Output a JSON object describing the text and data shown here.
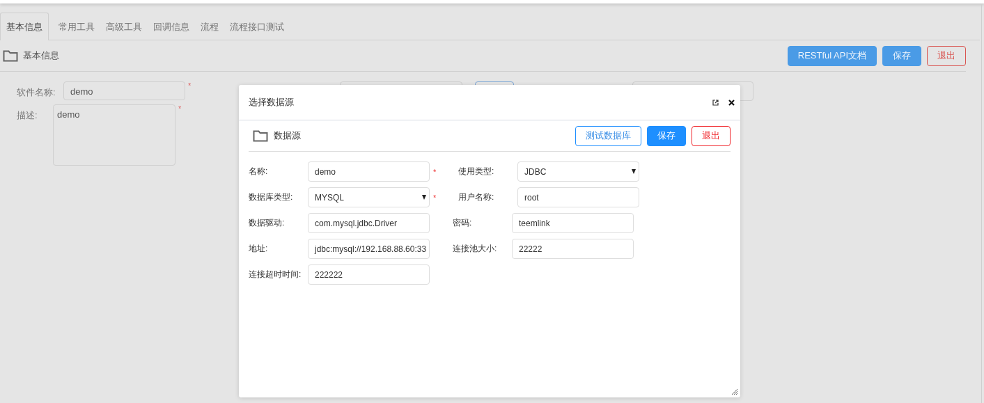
{
  "tabs": [
    {
      "label": "基本信息",
      "selected": true
    },
    {
      "label": "常用工具",
      "selected": false
    },
    {
      "label": "高级工具",
      "selected": false
    },
    {
      "label": "回调信息",
      "selected": false
    },
    {
      "label": "流程",
      "selected": false
    },
    {
      "label": "流程接口测试",
      "selected": false
    }
  ],
  "panel": {
    "title": "基本信息",
    "buttons": [
      {
        "label": "RESTful API文档",
        "kind": "primary"
      },
      {
        "label": "保存",
        "kind": "primary"
      },
      {
        "label": "退出",
        "kind": "danger"
      }
    ]
  },
  "form": {
    "fields": [
      {
        "label": "软件名称:",
        "value": "demo",
        "kind": "input",
        "mark": "*"
      },
      {
        "label": "描述:",
        "value": "demo",
        "kind": "textarea",
        "mark": "*"
      }
    ]
  },
  "dialog": {
    "title": "选择数据源",
    "header": {
      "title": "数据源",
      "buttons": [
        {
          "label": "测试数据库",
          "kind": "outline"
        },
        {
          "label": "保存",
          "kind": "primary"
        },
        {
          "label": "退出",
          "kind": "danger"
        }
      ]
    },
    "rows": [
      [
        {
          "label": "名称:",
          "value": "demo",
          "kind": "input",
          "mark": "*"
        },
        {
          "label": "使用类型:",
          "value": "JDBC",
          "kind": "select"
        }
      ],
      [
        {
          "label": "数据库类型:",
          "value": "MYSQL",
          "kind": "select",
          "mark": "*"
        },
        {
          "label": "用户名称:",
          "value": "root",
          "kind": "input"
        }
      ],
      [
        {
          "label": "数据驱动:",
          "value": "com.mysql.jdbc.Driver",
          "kind": "input"
        },
        {
          "label": "密码:",
          "value": "teemlink",
          "kind": "input"
        }
      ],
      [
        {
          "label": "地址:",
          "value": "jdbc:mysql://192.168.88.60:33",
          "kind": "input"
        },
        {
          "label": "连接池大小:",
          "value": "22222",
          "kind": "input"
        }
      ],
      [
        {
          "label": "连接超时时间:",
          "value": "222222",
          "kind": "input"
        }
      ]
    ]
  }
}
